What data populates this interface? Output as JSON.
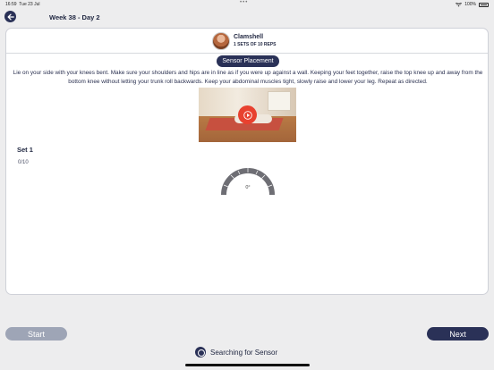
{
  "status_bar": {
    "time": "16:59",
    "date": "Tue 23 Jul",
    "center_dots": "•••",
    "wifi_icon": "wifi-icon",
    "battery_percent": "100%",
    "battery_icon": "battery-icon"
  },
  "nav": {
    "back_icon": "arrow-left-icon",
    "title": "Week 38 - Day 2"
  },
  "exercise": {
    "name": "Clamshell",
    "sets_reps": "1 SETS OF 10 REPS",
    "sensor_placement_label": "Sensor Placement",
    "instructions": "Lie on your side with your knees bent. Make sure your shoulders and hips are in line as if you were up against a wall. Keeping your feet together, raise the top knee up and away from the bottom knee without letting your trunk roll backwards. Keep your abdominal muscles tight, slowly raise and lower your leg. Repeat as directed.",
    "video_play_icon": "play-icon"
  },
  "set": {
    "title": "Set 1",
    "count": "0/10",
    "gauge_value": "0°",
    "gauge_level": 0
  },
  "footer": {
    "start_label": "Start",
    "next_label": "Next",
    "status_text": "Searching for Sensor",
    "status_icon": "sensor-icon"
  },
  "colors": {
    "primary": "#2a3157",
    "disabled": "#9ea5b6",
    "play": "#e8412f",
    "background": "#ededee"
  }
}
